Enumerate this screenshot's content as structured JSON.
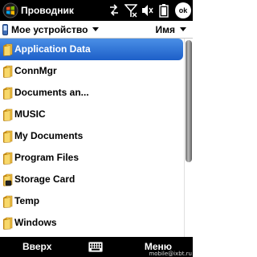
{
  "titlebar": {
    "title": "Проводник",
    "ok_label": "ok",
    "icons": [
      "windows-start-icon",
      "data-connection-icon",
      "signal-off-icon",
      "speaker-muted-icon",
      "battery-icon"
    ]
  },
  "navbar": {
    "location": "Мое устройство",
    "sort_by": "Имя"
  },
  "files": [
    {
      "name": "Application Data",
      "selected": true,
      "icon": "folder-icon"
    },
    {
      "name": "ConnMgr",
      "selected": false,
      "icon": "folder-icon"
    },
    {
      "name": "Documents an...",
      "selected": false,
      "icon": "folder-icon"
    },
    {
      "name": "MUSIC",
      "selected": false,
      "icon": "folder-icon"
    },
    {
      "name": "My Documents",
      "selected": false,
      "icon": "folder-icon"
    },
    {
      "name": "Program Files",
      "selected": false,
      "icon": "folder-icon"
    },
    {
      "name": "Storage Card",
      "selected": false,
      "icon": "storage-card-folder-icon"
    },
    {
      "name": "Temp",
      "selected": false,
      "icon": "folder-icon"
    },
    {
      "name": "Windows",
      "selected": false,
      "icon": "folder-icon"
    }
  ],
  "softkeys": {
    "left": "Вверх",
    "right": "Меню"
  },
  "watermark": "mobile@ixbt.ru",
  "colors": {
    "selection": "#2a6fd6",
    "bars": "#000000",
    "folder": "#e8b62c"
  }
}
